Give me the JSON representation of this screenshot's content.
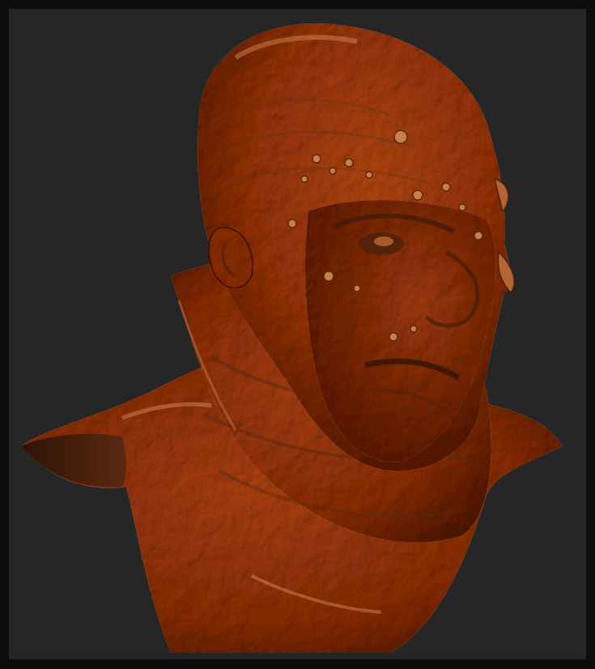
{
  "colors": {
    "outer_frame": "#0d0d0d",
    "viewport_background": "#262626",
    "clay_base": "#b5652f",
    "clay_highlight": "#d98a4e",
    "clay_shadow": "#5a2a10",
    "clay_deep_shadow": "#2e1406"
  },
  "viewport": {
    "content": "sculpted-creature-bust"
  }
}
